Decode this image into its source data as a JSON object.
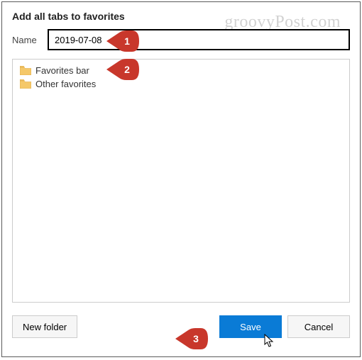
{
  "dialog": {
    "title": "Add all tabs to favorites",
    "name_label": "Name",
    "name_value": "2019-07-08"
  },
  "tree": {
    "items": [
      {
        "label": "Favorites bar"
      },
      {
        "label": "Other favorites"
      }
    ]
  },
  "buttons": {
    "new_folder": "New folder",
    "save": "Save",
    "cancel": "Cancel"
  },
  "callouts": {
    "c1": "1",
    "c2": "2",
    "c3": "3"
  },
  "watermark": "groovyPost.com"
}
